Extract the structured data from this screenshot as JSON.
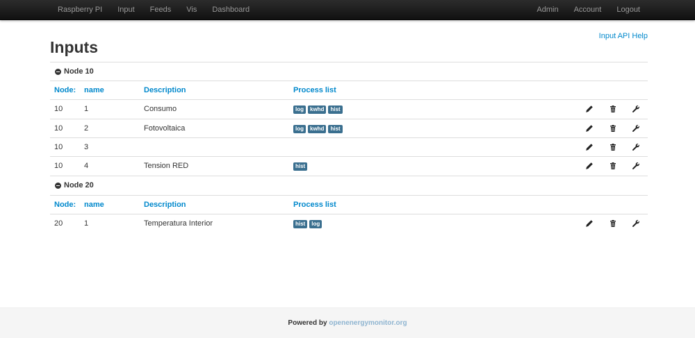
{
  "nav": {
    "left": [
      "Raspberry PI",
      "Input",
      "Feeds",
      "Vis",
      "Dashboard"
    ],
    "right": [
      "Admin",
      "Account",
      "Logout"
    ]
  },
  "help_link": "Input API Help",
  "page_title": "Inputs",
  "headers": {
    "node": "Node:",
    "name": "name",
    "description": "Description",
    "process": "Process list"
  },
  "groups": [
    {
      "label": "Node 10",
      "rows": [
        {
          "node": "10",
          "name": "1",
          "description": "Consumo",
          "processes": [
            "log",
            "kwhd",
            "hist"
          ]
        },
        {
          "node": "10",
          "name": "2",
          "description": "Fotovoltaica",
          "processes": [
            "log",
            "kwhd",
            "hist"
          ]
        },
        {
          "node": "10",
          "name": "3",
          "description": "",
          "processes": []
        },
        {
          "node": "10",
          "name": "4",
          "description": "Tension RED",
          "processes": [
            "hist"
          ]
        }
      ]
    },
    {
      "label": "Node 20",
      "rows": [
        {
          "node": "20",
          "name": "1",
          "description": "Temperatura Interior",
          "processes": [
            "hist",
            "log"
          ]
        }
      ]
    }
  ],
  "footer": {
    "prefix": "Powered by",
    "link": "openenergymonitor.org"
  },
  "colors": {
    "link": "#0088cc",
    "badge": "#3a6f8f",
    "navbar": "#1b1b1b",
    "footer_link": "#8fb5d1"
  },
  "icons": {
    "edit": "pencil-icon",
    "delete": "trash-icon",
    "process": "wrench-icon",
    "collapse": "minus-circle-icon"
  }
}
